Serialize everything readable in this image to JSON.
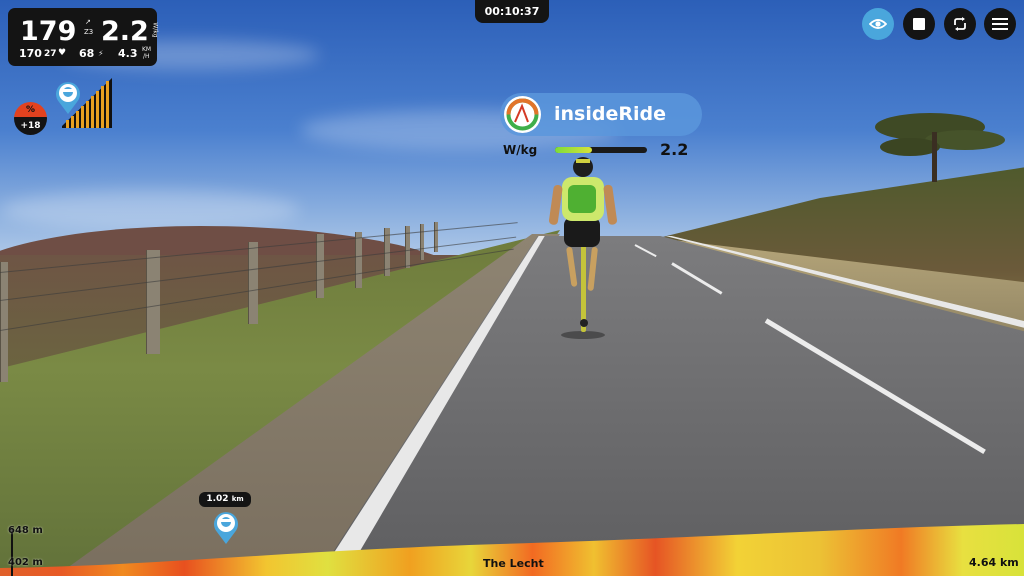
{
  "hud": {
    "power": "179",
    "power_zone_top": "↗",
    "power_zone": "Z3",
    "wkg": "2.2",
    "wkg_unit": "W/kg",
    "heart_rate": "170",
    "cadence": "27",
    "avg_power": "68",
    "speed": "4.3",
    "speed_unit_top": "KM",
    "speed_unit_bottom": "/H"
  },
  "timer": "00:10:37",
  "toolbar": {
    "view_icon": "eye-icon",
    "stop_icon": "stop-icon",
    "loop_icon": "loop-icon",
    "menu_icon": "menu-icon"
  },
  "gradient": {
    "symbol": "%",
    "value": "+18"
  },
  "brand": {
    "name": "insideRide",
    "metric_label": "W/kg",
    "metric_value": "2.2",
    "metric_fill": 0.4
  },
  "progress": {
    "distance_value": "1.02",
    "distance_unit": "km",
    "elev_max": "648 m",
    "elev_min": "402 m",
    "route_name": "The Lecht",
    "route_total": "4.64 km"
  },
  "colors": {
    "panel": "#141414",
    "accent_blue": "#4aa6dc",
    "gradient_red": "#e2421f"
  }
}
